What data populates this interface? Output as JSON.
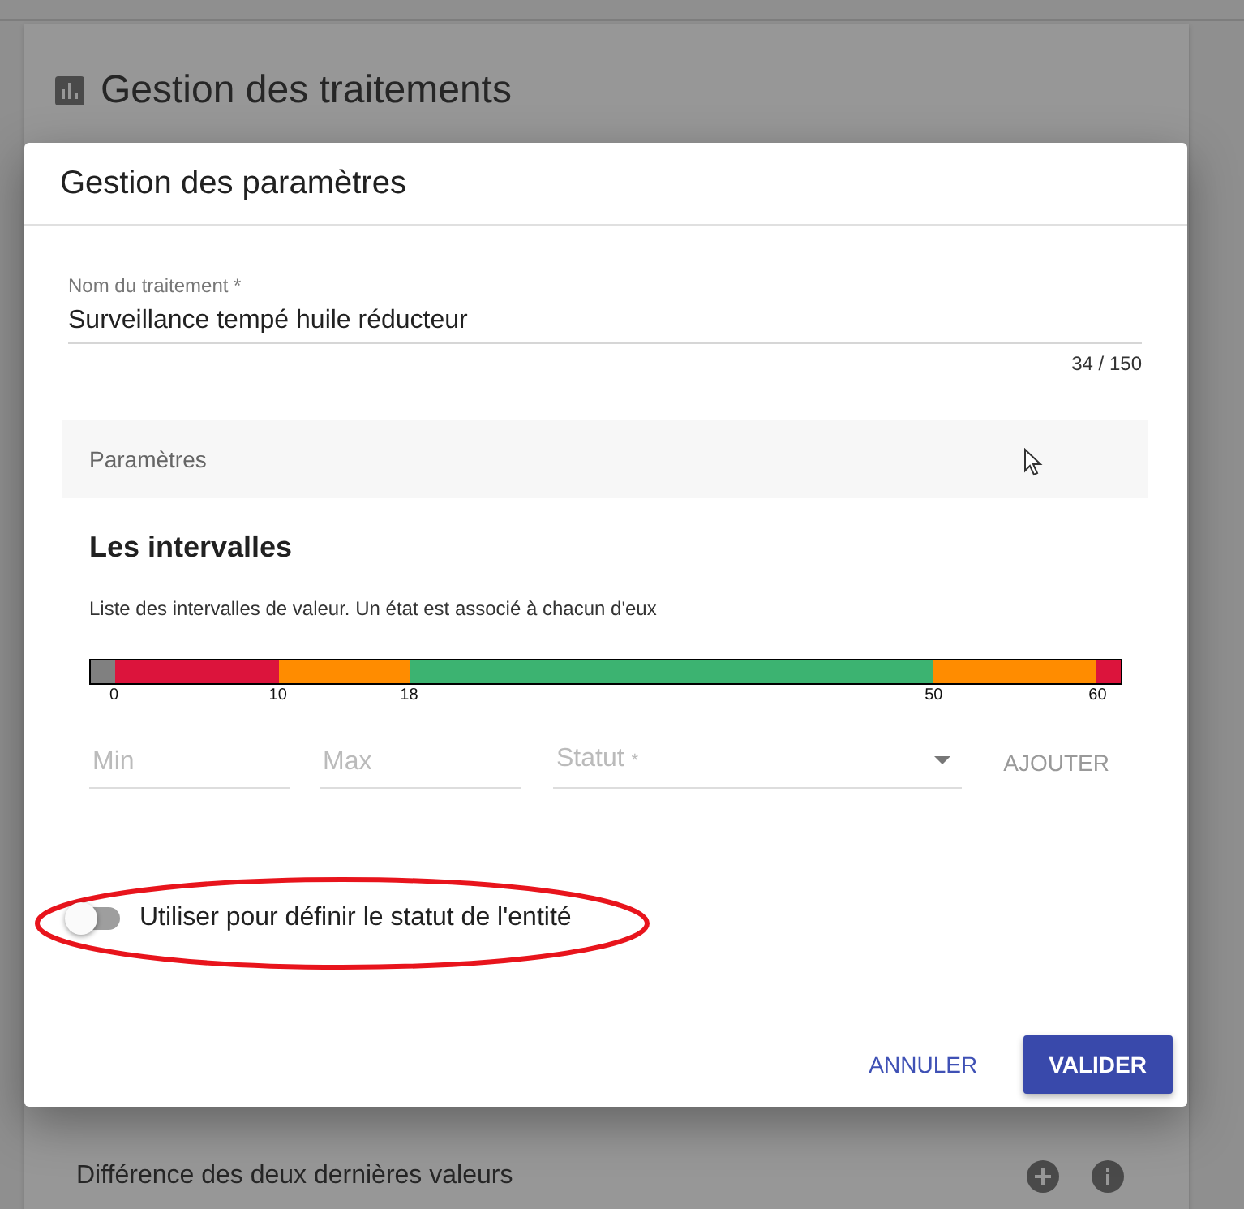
{
  "page": {
    "title": "Gestion des traitements",
    "rows": [
      {
        "label": "Différence des deux dernières valeurs"
      }
    ]
  },
  "dialog": {
    "title": "Gestion des paramètres",
    "name_field": {
      "label": "Nom du traitement",
      "required_mark": "*",
      "value": "Surveillance tempé huile réducteur",
      "counter": "34 / 150"
    },
    "panel": {
      "title": "Paramètres"
    },
    "intervals": {
      "heading": "Les intervalles",
      "description": "Liste des intervalles de valeur. Un état est associé à chacun d'eux",
      "ticks": [
        "0",
        "10",
        "18",
        "50",
        "60"
      ],
      "segments": [
        {
          "color": "#808080"
        },
        {
          "color": "#dc143c"
        },
        {
          "color": "#ff8c00"
        },
        {
          "color": "#3cb371"
        },
        {
          "color": "#ff8c00"
        },
        {
          "color": "#dc143c"
        }
      ],
      "min_field": {
        "placeholder": "Min"
      },
      "max_field": {
        "placeholder": "Max"
      },
      "status_select": {
        "placeholder": "Statut",
        "required_mark": "*"
      },
      "add_button": "AJOUTER"
    },
    "entity_status_toggle": {
      "label": "Utiliser pour définir le statut de l'entité",
      "on": false
    },
    "buttons": [
      {
        "label": "ANNULER",
        "kind": "text"
      },
      {
        "label": "VALIDER",
        "kind": "filled"
      }
    ]
  }
}
